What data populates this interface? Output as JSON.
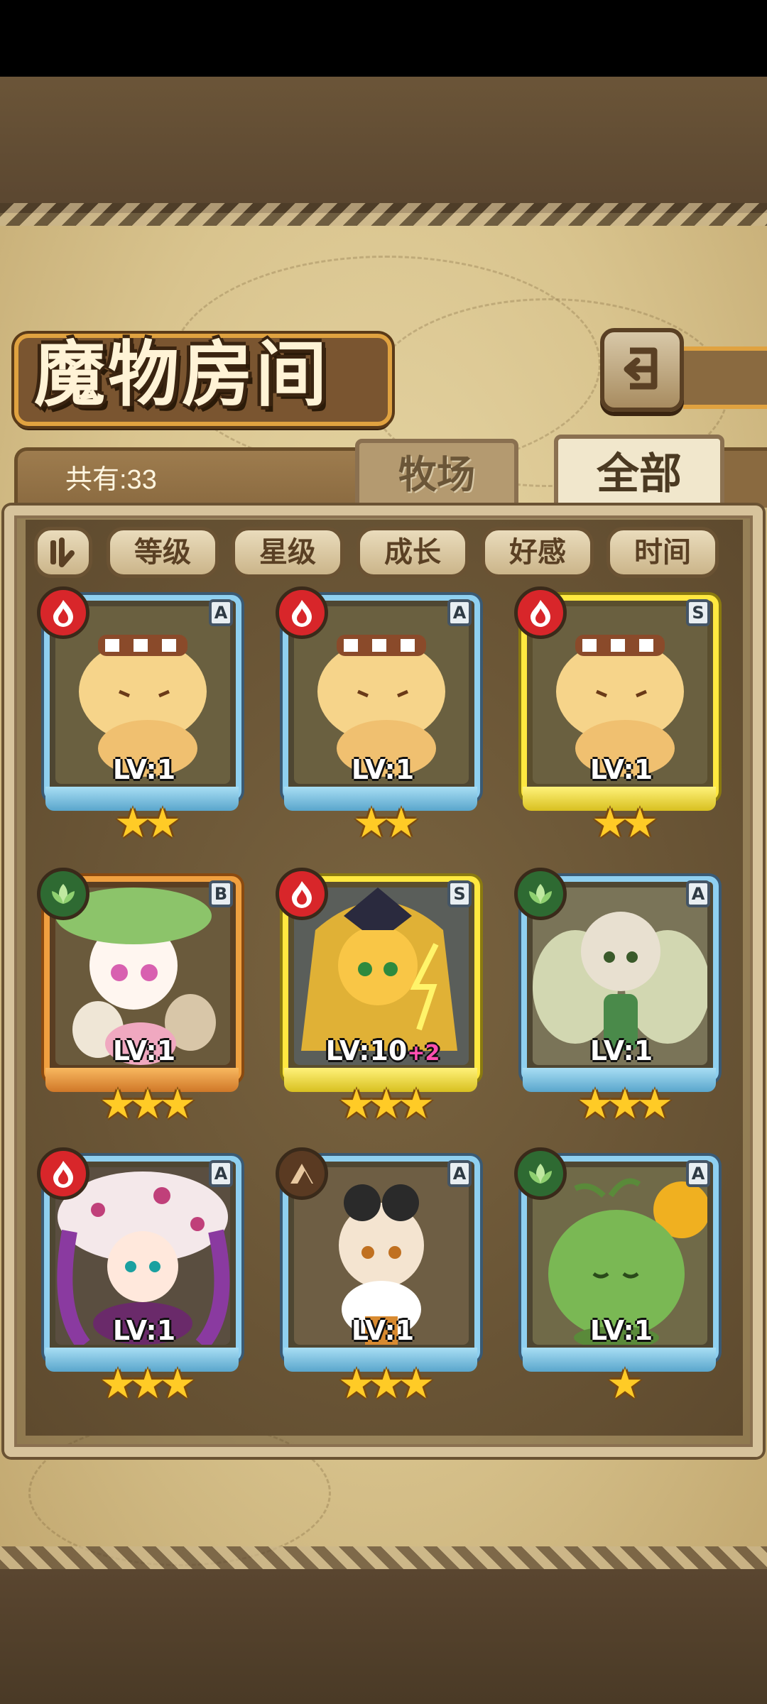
{
  "title": "魔物房间",
  "icons": {
    "back": "back-return-icon",
    "sort_toggle": "sort-order-icon"
  },
  "count_label": "共有:33",
  "tabs": [
    {
      "label": "牧场",
      "active": false
    },
    {
      "label": "全部",
      "active": true
    }
  ],
  "sort_buttons": [
    "等级",
    "星级",
    "成长",
    "好感",
    "时间"
  ],
  "colors": {
    "fire": "#d8262a",
    "leaf": "#2e6a32",
    "earth": "#5a3a22",
    "frame_blue": "#8fd0f0",
    "frame_gold": "#ffe840",
    "frame_orange": "#f0a040",
    "star": "#ffcb26",
    "bonus": "#ff4fb0"
  },
  "monsters": [
    {
      "element": "fire",
      "grade": "A",
      "level": "LV:1",
      "bonus": "",
      "stars": "★★",
      "star_count": 2,
      "art": "pudding"
    },
    {
      "element": "fire",
      "grade": "A",
      "level": "LV:1",
      "bonus": "",
      "stars": "★★",
      "star_count": 2,
      "art": "pudding"
    },
    {
      "element": "fire",
      "grade": "S",
      "level": "LV:1",
      "bonus": "",
      "stars": "★★",
      "star_count": 2,
      "art": "pudding"
    },
    {
      "element": "leaf",
      "grade": "B",
      "level": "LV:1",
      "bonus": "",
      "stars": "★★★",
      "star_count": 3,
      "art": "lotus-girl"
    },
    {
      "element": "fire",
      "grade": "S",
      "level": "LV:10",
      "bonus": "+2",
      "stars": "★★★",
      "star_count": 3,
      "art": "thunder-girl"
    },
    {
      "element": "leaf",
      "grade": "A",
      "level": "LV:1",
      "bonus": "",
      "stars": "★★★",
      "star_count": 3,
      "art": "fairy-girl"
    },
    {
      "element": "fire",
      "grade": "A",
      "level": "LV:1",
      "bonus": "",
      "stars": "★★★",
      "star_count": 3,
      "art": "mushroom-girl"
    },
    {
      "element": "earth",
      "grade": "A",
      "level": "LV:1",
      "bonus": "",
      "stars": "★★★",
      "star_count": 3,
      "art": "goggle-girl"
    },
    {
      "element": "leaf",
      "grade": "A",
      "level": "LV:1",
      "bonus": "",
      "stars": "★",
      "star_count": 1,
      "art": "slime-sprout"
    }
  ]
}
